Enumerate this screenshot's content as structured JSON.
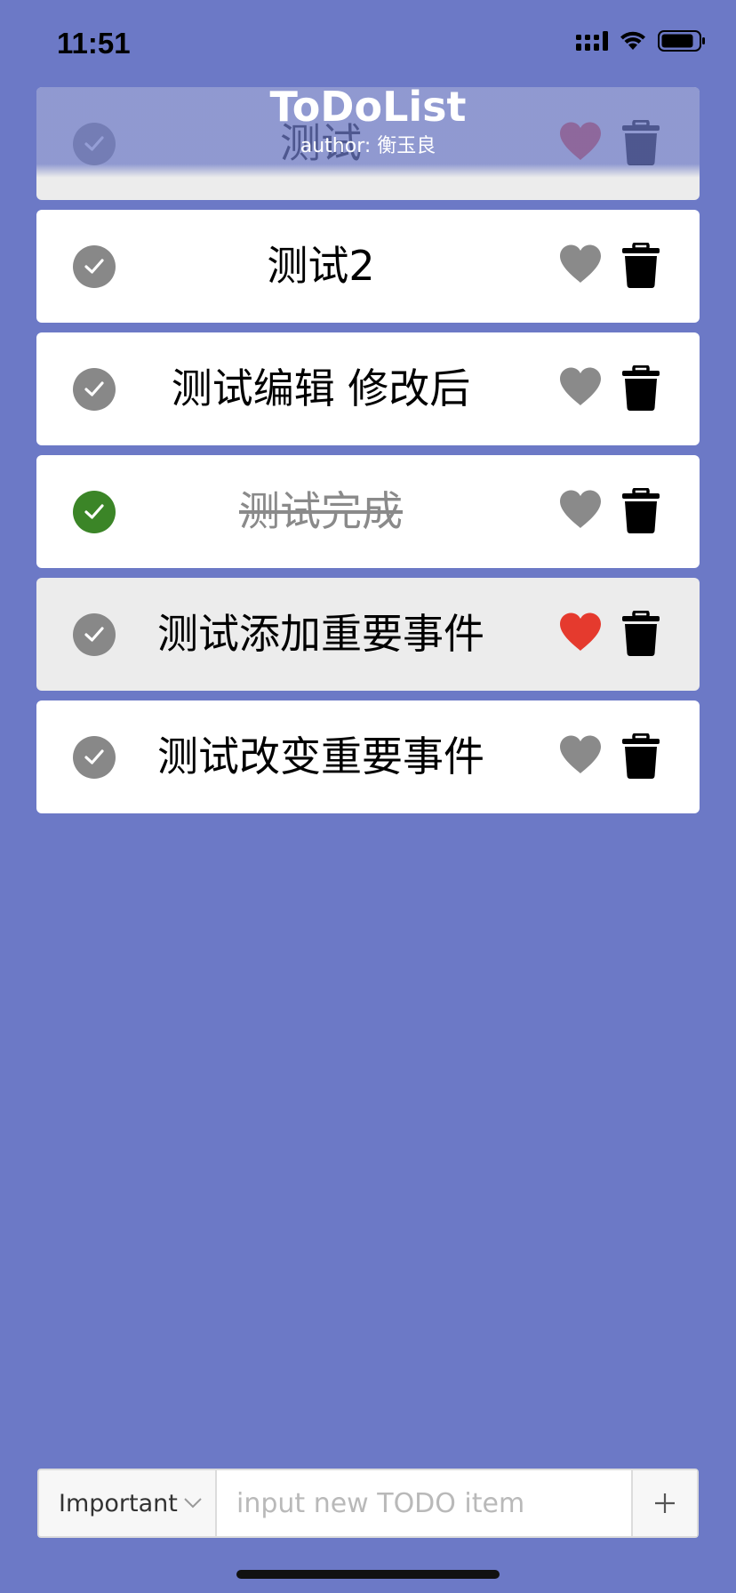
{
  "status_bar": {
    "time": "11:51",
    "icons": [
      "cellular-signal-icon",
      "wifi-icon",
      "battery-icon"
    ]
  },
  "header": {
    "title": "ToDoList",
    "author": "author: 衡玉良"
  },
  "todos": [
    {
      "text": "测试",
      "completed": false,
      "important": true
    },
    {
      "text": "测试2",
      "completed": false,
      "important": false
    },
    {
      "text": "测试编辑 修改后",
      "completed": false,
      "important": false
    },
    {
      "text": "测试完成",
      "completed": true,
      "important": false
    },
    {
      "text": "测试添加重要事件",
      "completed": false,
      "important": true
    },
    {
      "text": "测试改变重要事件",
      "completed": false,
      "important": false
    }
  ],
  "input_bar": {
    "priority_selected": "Important",
    "placeholder": "input new TODO item",
    "value": "",
    "add_label": "+"
  },
  "colors": {
    "background": "#6c79c6",
    "check_default": "#888888",
    "check_done": "#3b8527",
    "heart_important": "#e53a2e",
    "heart_default": "#8a8a8a",
    "heart_faded": "#a2578a",
    "trash_faded": "#4a5490"
  }
}
